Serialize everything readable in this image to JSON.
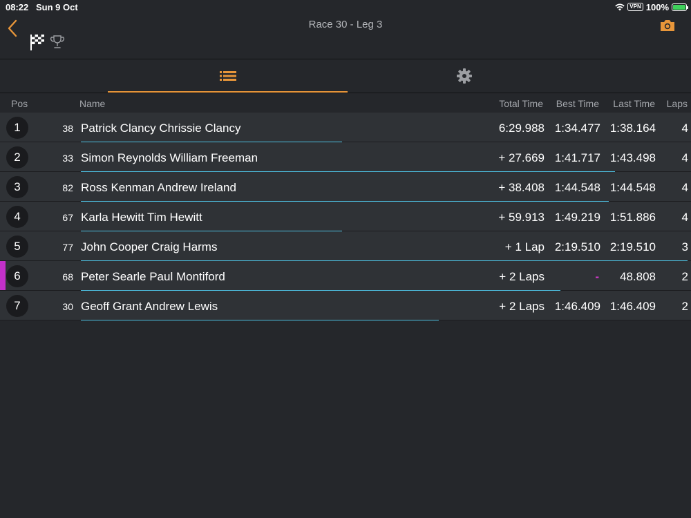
{
  "status": {
    "time": "08:22",
    "date": "Sun 9 Oct",
    "vpn": "VPN",
    "battery": "100%",
    "battery_color": "#3ed05a"
  },
  "header": {
    "title": "Race 30 -  Leg 3",
    "icons": [
      "back-chevron-icon",
      "checkered-flag-icon",
      "trophy-icon",
      "camera-icon"
    ],
    "accent": "#e8963a"
  },
  "tabs": [
    {
      "name": "list",
      "icon": "list-icon",
      "active": true
    },
    {
      "name": "settings",
      "icon": "gear-icon",
      "active": false
    }
  ],
  "columns": {
    "pos": "Pos",
    "name": "Name",
    "total": "Total Time",
    "best": "Best Time",
    "last": "Last Time",
    "laps": "Laps"
  },
  "rows": [
    {
      "pos": "1",
      "num": "38",
      "name": "Patrick Clancy Chrissie Clancy",
      "total": "6:29.988",
      "best": "1:34.477",
      "last": "1:38.164",
      "laps": "4",
      "progress": 0.43
    },
    {
      "pos": "2",
      "num": "33",
      "name": "Simon Reynolds William Freeman",
      "total": "+ 27.669",
      "best": "1:41.717",
      "last": "1:43.498",
      "laps": "4",
      "progress": 0.88
    },
    {
      "pos": "3",
      "num": "82",
      "name": "Ross Kenman Andrew Ireland",
      "total": "+ 38.408",
      "best": "1:44.548",
      "last": "1:44.548",
      "laps": "4",
      "progress": 0.87
    },
    {
      "pos": "4",
      "num": "67",
      "name": "Karla Hewitt Tim Hewitt",
      "total": "+ 59.913",
      "best": "1:49.219",
      "last": "1:51.886",
      "laps": "4",
      "progress": 0.43
    },
    {
      "pos": "5",
      "num": "77",
      "name": "John Cooper Craig Harms",
      "total": "+ 1 Lap",
      "best": "2:19.510",
      "last": "2:19.510",
      "laps": "3",
      "progress": 1.0
    },
    {
      "pos": "6",
      "num": "68",
      "name": "Peter Searle Paul Montiford",
      "total": "+ 2 Laps",
      "best": "-",
      "last": "48.808",
      "laps": "2",
      "progress": 0.79,
      "marker": true
    },
    {
      "pos": "7",
      "num": "30",
      "name": "Geoff Grant Andrew Lewis",
      "total": "+ 2 Laps",
      "best": "1:46.409",
      "last": "1:46.409",
      "laps": "2",
      "progress": 0.59
    }
  ]
}
